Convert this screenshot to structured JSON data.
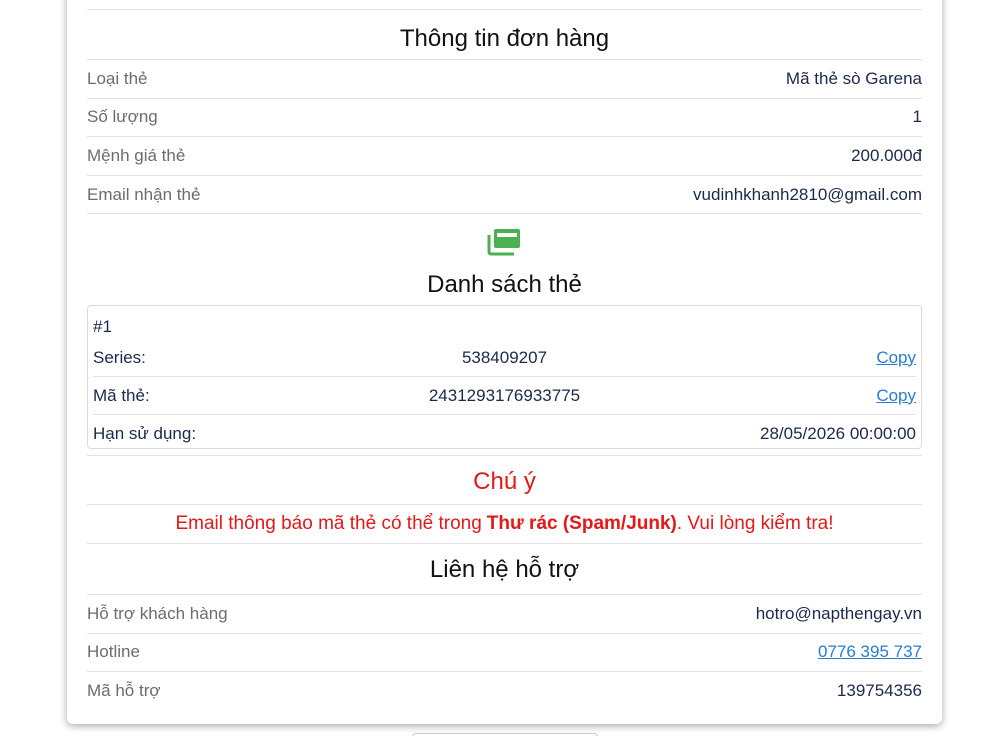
{
  "order": {
    "title": "Thông tin đơn hàng",
    "rows": [
      {
        "label": "Loại thẻ",
        "value": "Mã thẻ sò Garena"
      },
      {
        "label": "Số lượng",
        "value": "1"
      },
      {
        "label": "Mệnh giá thẻ",
        "value": "200.000đ"
      },
      {
        "label": "Email nhận thẻ",
        "value": "vudinhkhanh2810@gmail.com"
      }
    ]
  },
  "card_list": {
    "icon": "cards-icon",
    "icon_color": "#4caf50",
    "title": "Danh sách thẻ",
    "index": "#1",
    "series_label": "Series:",
    "series_value": "538409207",
    "code_label": "Mã thẻ:",
    "code_value": "2431293176933775",
    "copy_label": "Copy",
    "expiry_label": "Hạn sử dụng:",
    "expiry_value": "28/05/2026 00:00:00"
  },
  "note": {
    "title": "Chú ý",
    "text_before": "Email thông báo mã thẻ có thể trong",
    "text_bold": "Thư rác (Spam/Junk)",
    "text_after": ". Vui lòng kiểm tra!",
    "color": "#e31818"
  },
  "support": {
    "title": "Liên hệ hỗ trợ",
    "customer_label": "Hỗ trợ khách hàng",
    "customer_value": "hotro@napthengay.vn",
    "hotline_label": "Hotline",
    "hotline_value": "0776 395 737",
    "code_label": "Mã hỗ trợ",
    "code_value": "139754356"
  }
}
